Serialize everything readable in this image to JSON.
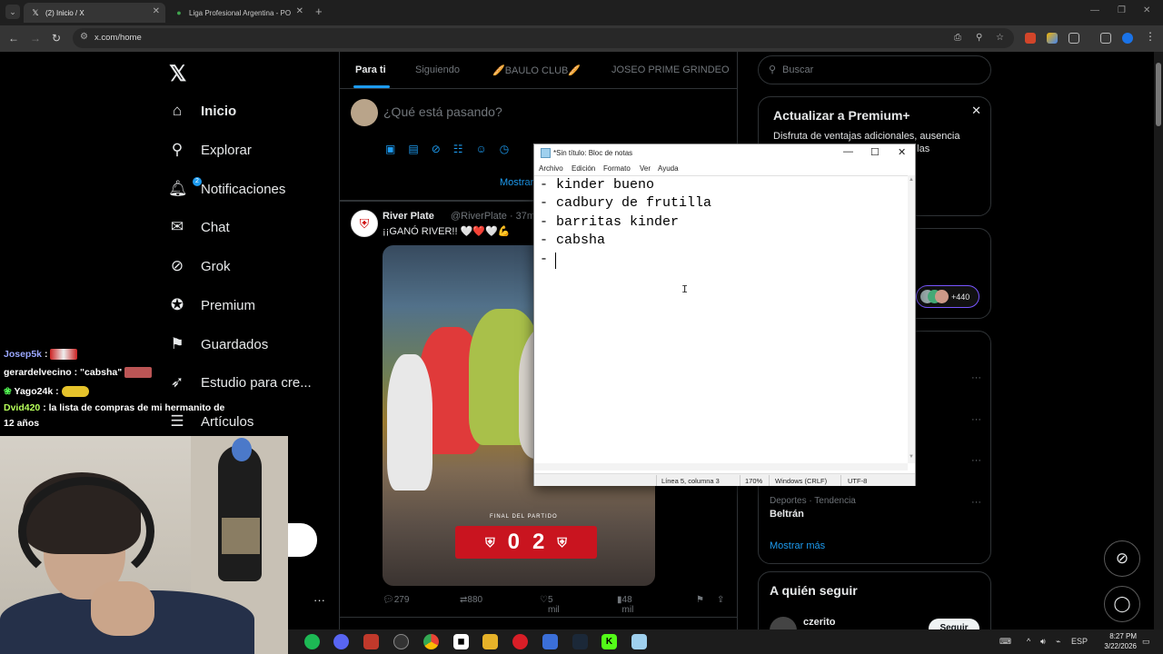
{
  "browser": {
    "tabs": [
      {
        "title": "(2) Inicio / X",
        "active": true
      },
      {
        "title": "Liga Profesional Argentina - PO",
        "active": false
      }
    ],
    "url": "x.com/home"
  },
  "x": {
    "nav": [
      {
        "label": "Inicio",
        "icon": "home-icon"
      },
      {
        "label": "Explorar",
        "icon": "search-icon"
      },
      {
        "label": "Notificaciones",
        "icon": "bell-icon",
        "badge": "2"
      },
      {
        "label": "Chat",
        "icon": "mail-icon"
      },
      {
        "label": "Grok",
        "icon": "grok-icon"
      },
      {
        "label": "Premium",
        "icon": "verified-icon"
      },
      {
        "label": "Guardados",
        "icon": "bookmark-icon"
      },
      {
        "label": "Estudio para cre...",
        "icon": "rocket-icon"
      },
      {
        "label": "Artículos",
        "icon": "article-icon"
      }
    ],
    "more_label": "···",
    "feed_tabs": [
      "Para ti",
      "Siguiendo",
      "🥖BAULO CLUB🥖",
      "JOSEO PRIME GRINDEO"
    ],
    "compose_placeholder": "¿Qué está pasando?",
    "show_more": "Mostrar",
    "post": {
      "name": "River Plate",
      "handle": "@RiverPlate · 37m",
      "text": "¡¡GANÓ RIVER!! 🤍❤️🤍💪",
      "final_label": "FINAL DEL PARTIDO",
      "score_home": "0",
      "score_away": "2",
      "replies": "279",
      "reposts": "880",
      "likes": "5 mil",
      "views": "48 mil"
    },
    "search_placeholder": "Buscar",
    "premium": {
      "title": "Actualizar a Premium+",
      "text_line1": "Disfruta de ventajas adicionales, ausencia",
      "text_line2": "zación en las"
    },
    "live_count": "+440",
    "trend": {
      "category": "Deportes · Tendencia",
      "name": "Beltrán"
    },
    "show_more_trends": "Mostrar más",
    "who_to_follow": {
      "title": "A quién seguir",
      "name": "czerito",
      "button": "Seguir"
    }
  },
  "chat": [
    {
      "user": "Josep5k",
      "msg": "",
      "color": "#9aa7ff"
    },
    {
      "user": "gerardelvecino",
      "msg": "\"cabsha\"",
      "color": "#ffffff"
    },
    {
      "user": "Yago24k",
      "msg": "",
      "color": "#ffffff"
    },
    {
      "user": "Dvid420",
      "msg": "la lista de compras de mi hermanito de",
      "color": "#b6ff5a"
    },
    {
      "user": "",
      "msg": "12 años",
      "color": "#ffffff"
    }
  ],
  "notepad": {
    "title": "*Sin título: Bloc de notas",
    "menu": [
      "Archivo",
      "Edición",
      "Formato",
      "Ver",
      "Ayuda"
    ],
    "lines": [
      "- kinder bueno",
      "- cadbury de frutilla",
      "- barritas kinder",
      "- cabsha",
      "- "
    ],
    "status": {
      "position": "Línea 5, columna 3",
      "zoom": "170%",
      "eol": "Windows (CRLF)",
      "encoding": "UTF-8"
    }
  },
  "taskbar": {
    "clock_time": "8:27 PM",
    "clock_date": "3/22/2026",
    "lang": "ESP"
  },
  "colors": {
    "accent": "#1d9bf0",
    "bg": "#000000",
    "border": "#2f3336",
    "river_red": "#c9141f"
  }
}
